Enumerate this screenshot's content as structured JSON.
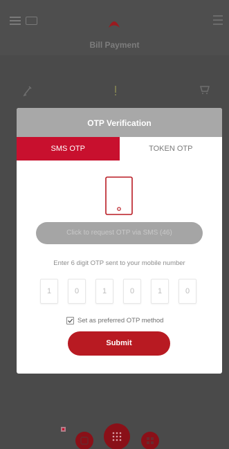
{
  "header": {
    "page_title": "Bill Payment",
    "menu_icon": "hamburger-menu-icon",
    "card_icon": "card-icon",
    "logo_icon": "brand-logo-icon"
  },
  "modal": {
    "title": "OTP Verification",
    "tabs": [
      {
        "label": "SMS OTP",
        "active": true
      },
      {
        "label": "TOKEN OTP",
        "active": false
      }
    ],
    "request_button_label": "Click to request OTP via SMS (46)",
    "instruction": "Enter 6 digit OTP sent to your mobile number",
    "otp_digits": [
      "1",
      "0",
      "1",
      "0",
      "1",
      "0"
    ],
    "preferred_label": "Set as preferred OTP method",
    "preferred_checked": true,
    "submit_label": "Submit"
  },
  "colors": {
    "accent": "#c8102e",
    "submit": "#b81a22",
    "title_bar": "#a8a8a8",
    "request_button": "#a5a5a5",
    "overlay": "#4a4a4a"
  },
  "icons": {
    "phone": "mobile-phone-icon",
    "checkbox": "checkmark-icon",
    "dock_center": "grid-icon"
  }
}
